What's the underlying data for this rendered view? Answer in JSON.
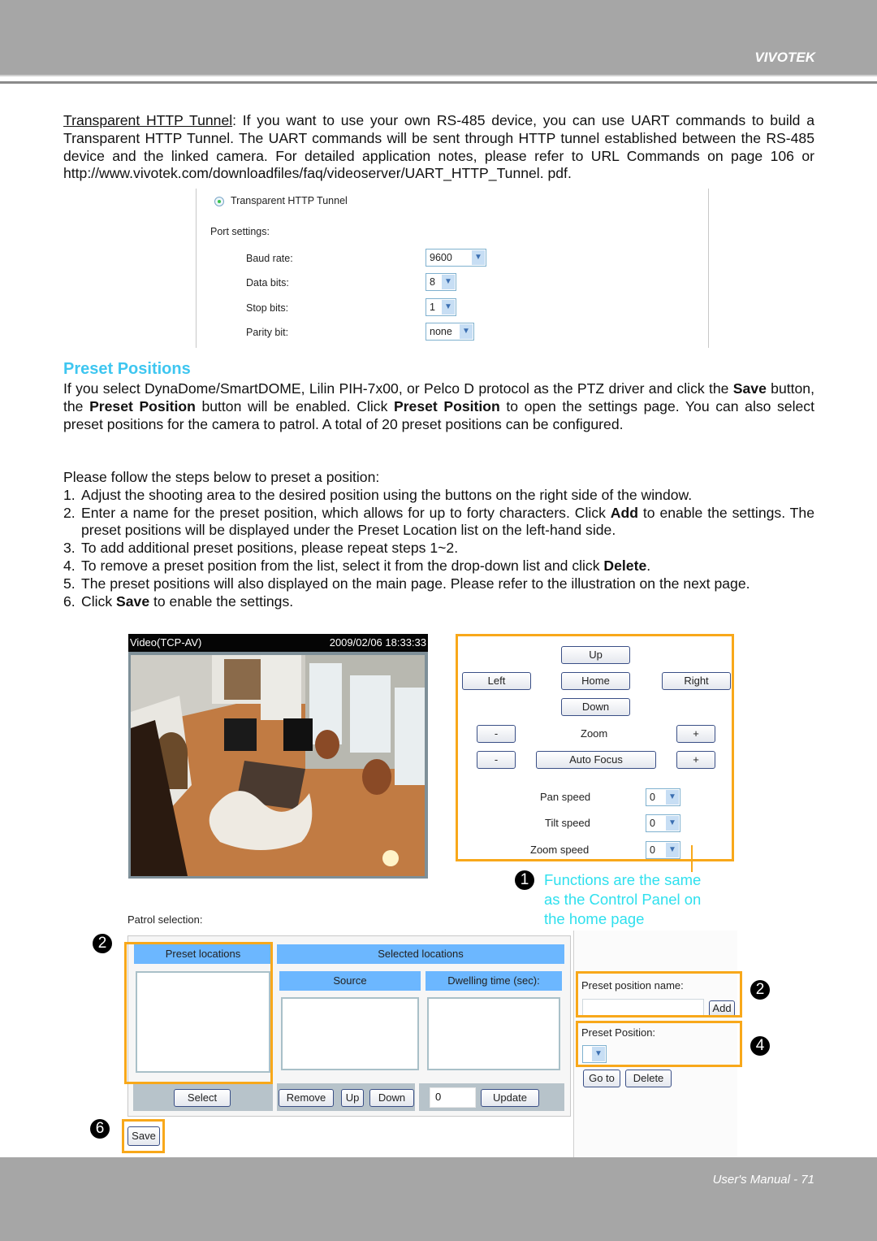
{
  "header": {
    "brand": "VIVOTEK"
  },
  "footer": {
    "page_label": "User's Manual - 71"
  },
  "intro": {
    "term": "Transparent HTTP Tunnel",
    "text": ": If you want to use your own RS-485 device, you can use UART commands to build a Transparent HTTP Tunnel. The UART commands will be sent through HTTP tunnel established between the RS-485 device and the linked camera. For detailed application notes, please refer to URL Commands on page 106 or http://www.vivotek.com/downloadfiles/faq/videoserver/UART_HTTP_Tunnel. pdf."
  },
  "tunnel_settings": {
    "radio_label": "Transparent HTTP Tunnel",
    "port_settings_label": "Port settings:",
    "fields": [
      {
        "label": "Baud rate:",
        "value": "9600"
      },
      {
        "label": "Data bits:",
        "value": "8"
      },
      {
        "label": "Stop bits:",
        "value": "1"
      },
      {
        "label": "Parity bit:",
        "value": "none"
      }
    ]
  },
  "section": {
    "title": "Preset Positions",
    "p1_a": "If you select DynaDome/SmartDOME, Lilin PIH-7x00, or Pelco D protocol as the PTZ driver and click the ",
    "p1_b1": "Save",
    "p1_c": " button, the ",
    "p1_b2": "Preset Position",
    "p1_d": " button will be enabled. Click ",
    "p1_b3": "Preset Position",
    "p1_e": " to open the settings page. You can also select preset positions for the camera to patrol. A total of 20 preset positions can be configured.",
    "steps_intro": "Please follow the steps below to preset a position:",
    "steps": [
      {
        "num": "1.",
        "text": "Adjust the shooting area to the desired position using the buttons on the right side of the window."
      },
      {
        "num": "2.",
        "pre": "Enter a name for the preset position, which allows for up to forty characters. Click ",
        "bold": "Add",
        "post": " to enable the settings. The preset positions will be displayed under the Preset Location list on the left-hand side."
      },
      {
        "num": "3.",
        "text": "To add additional preset positions, please repeat steps 1~2."
      },
      {
        "num": "4.",
        "pre": "To remove a preset position from the list, select it from the drop-down list and click ",
        "bold": "Delete",
        "post": "."
      },
      {
        "num": "5.",
        "text": "The preset positions will also displayed on the main page. Please refer to the illustration on the next page."
      },
      {
        "num": "6.",
        "pre": "Click ",
        "bold": "Save",
        "post": " to enable the settings."
      }
    ]
  },
  "video": {
    "stream_label": "Video(TCP-AV)",
    "timestamp": "2009/02/06 18:33:33"
  },
  "control_panel": {
    "up": "Up",
    "left": "Left",
    "home": "Home",
    "right": "Right",
    "down": "Down",
    "zoom_label": "Zoom",
    "zoom_minus": "-",
    "zoom_plus": "+",
    "focus_label": "Auto Focus",
    "focus_minus": "-",
    "focus_plus": "+",
    "pan_speed_label": "Pan speed",
    "pan_speed": "0",
    "tilt_speed_label": "Tilt speed",
    "tilt_speed": "0",
    "zoom_speed_label": "Zoom speed",
    "zoom_speed": "0"
  },
  "callouts": {
    "badge1": "1",
    "note": [
      "Functions are the same",
      "as the Control Panel on",
      "the home page"
    ],
    "badge2_left": "2",
    "badge2_right": "2",
    "badge4": "4",
    "badge6": "6"
  },
  "patrol": {
    "label": "Patrol selection:",
    "preset_locations": "Preset locations",
    "selected_locations": "Selected locations",
    "source": "Source",
    "dwelling_time": "Dwelling time (sec):",
    "select_btn": "Select",
    "remove_btn": "Remove",
    "up_btn": "Up",
    "down_btn": "Down",
    "dwell_value": "0",
    "update_btn": "Update",
    "save_btn": "Save"
  },
  "preset_panel": {
    "name_label": "Preset position name:",
    "name_value": "",
    "add_btn": "Add",
    "position_label": "Preset Position:",
    "position_value": "",
    "goto_btn": "Go to",
    "delete_btn": "Delete"
  },
  "colors": {
    "accent_title": "#3ec6f0",
    "callout_text": "#2fe0ee",
    "highlight_border": "#f8a81a",
    "table_header": "#6cb7ff"
  }
}
